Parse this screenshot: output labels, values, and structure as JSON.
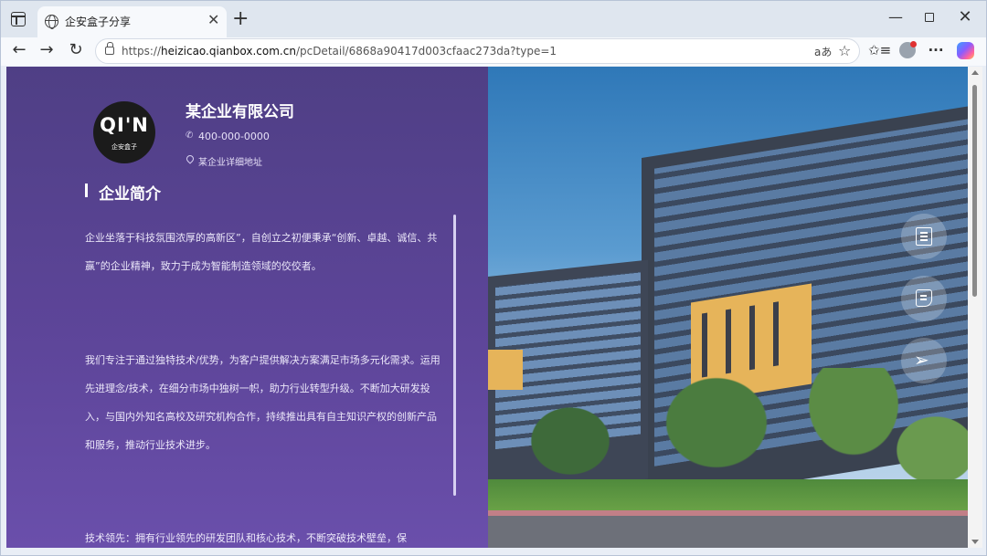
{
  "browser": {
    "tab_title": "企安盒子分享",
    "tab_close": "✕",
    "new_tab": "+",
    "window": {
      "minimize": "—",
      "close": "✕"
    },
    "nav": {
      "back": "←",
      "forward": "→",
      "reload": "↻"
    },
    "url_prefix": "https://",
    "url_host": "heizicao.qianbox.com.cn",
    "url_path": "/pcDetail/6868a90417d003cfaac273da?type=1",
    "read_aloud": "aあ",
    "favorite_star": "☆",
    "toolbar_favorites": "✩≡",
    "more": "···"
  },
  "company": {
    "logo_main": "QI'N",
    "logo_sub": "企安盒子",
    "name": "某企业有限公司",
    "phone_icon": "✆",
    "phone": "400-000-0000",
    "address": "某企业详细地址"
  },
  "intro": {
    "title": "企业简介",
    "paragraphs": [
      "企业坐落于科技氛围浓厚的高新区”，自创立之初便秉承“创新、卓越、诚信、共赢”的企业精神，致力于成为智能制造领域的佼佼者。",
      "我们专注于通过独特技术/优势，为客户提供解决方案满足市场多元化需求。运用先进理念/技术，在细分市场中独树一帜，助力行业转型升级。不断加大研发投入，与国内外知名高校及研究机构合作，持续推出具有自主知识产权的创新产品和服务，推动行业技术进步。",
      "技术领先：拥有行业领先的研发团队和核心技术，不断突破技术壁垒，保"
    ]
  },
  "floating_actions": {
    "send_glyph": "➢"
  }
}
